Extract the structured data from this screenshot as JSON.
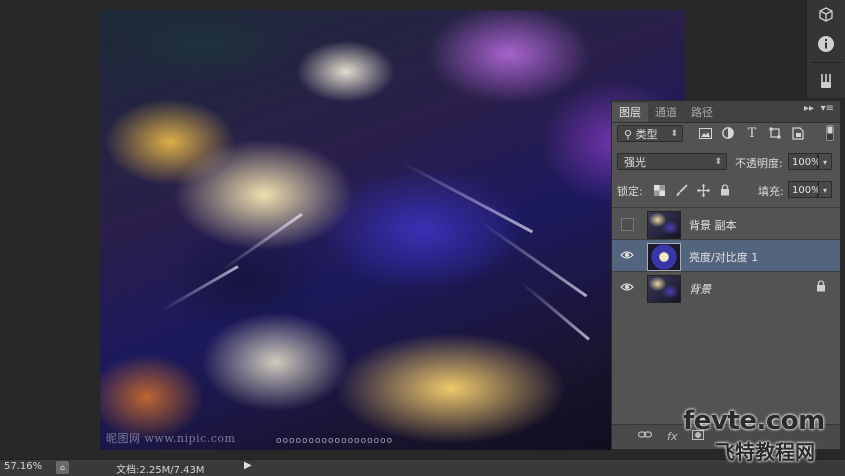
{
  "canvas": {
    "watermark": "昵图网 www.nipic.com",
    "watermark_dots": "oooooooooooooooooo"
  },
  "toolstrip": {
    "icons": [
      "cube-3d-icon",
      "info-icon",
      "brush-tools-icon"
    ]
  },
  "layers_panel": {
    "tabs": [
      {
        "label": "图层",
        "active": true
      },
      {
        "label": "通道",
        "active": false
      },
      {
        "label": "路径",
        "active": false
      }
    ],
    "collapse_glyph": "▸▸",
    "menu_glyph": "▾≡",
    "filter": {
      "label": "类型",
      "icon_glyph": "⚲"
    },
    "blend_mode": "强光",
    "opacity_label": "不透明度:",
    "opacity_value": "100%",
    "lock_label": "锁定:",
    "fill_label": "填充:",
    "fill_value": "100%",
    "layers": [
      {
        "name": "背景 副本",
        "visible": false,
        "selected": false,
        "type": "pixel",
        "italic": false,
        "locked": false
      },
      {
        "name": "亮度/对比度 1",
        "visible": true,
        "selected": true,
        "type": "adjustment",
        "italic": false,
        "locked": false
      },
      {
        "name": "背景",
        "visible": true,
        "selected": false,
        "type": "pixel",
        "italic": true,
        "locked": true
      }
    ],
    "footer_icons": [
      "link-icon",
      "fx-icon",
      "mask-icon"
    ],
    "footer_labels": {
      "fx": "fx"
    }
  },
  "statusbar": {
    "zoom": "57.16%",
    "docsize": "文档:2.25M/7.43M"
  },
  "site": {
    "logo": "fevte.com",
    "logo_cn": "飞特教程网"
  },
  "colors": {
    "selected_layer": "#52647e",
    "panel_bg": "#535353",
    "workspace_bg": "#282828"
  }
}
